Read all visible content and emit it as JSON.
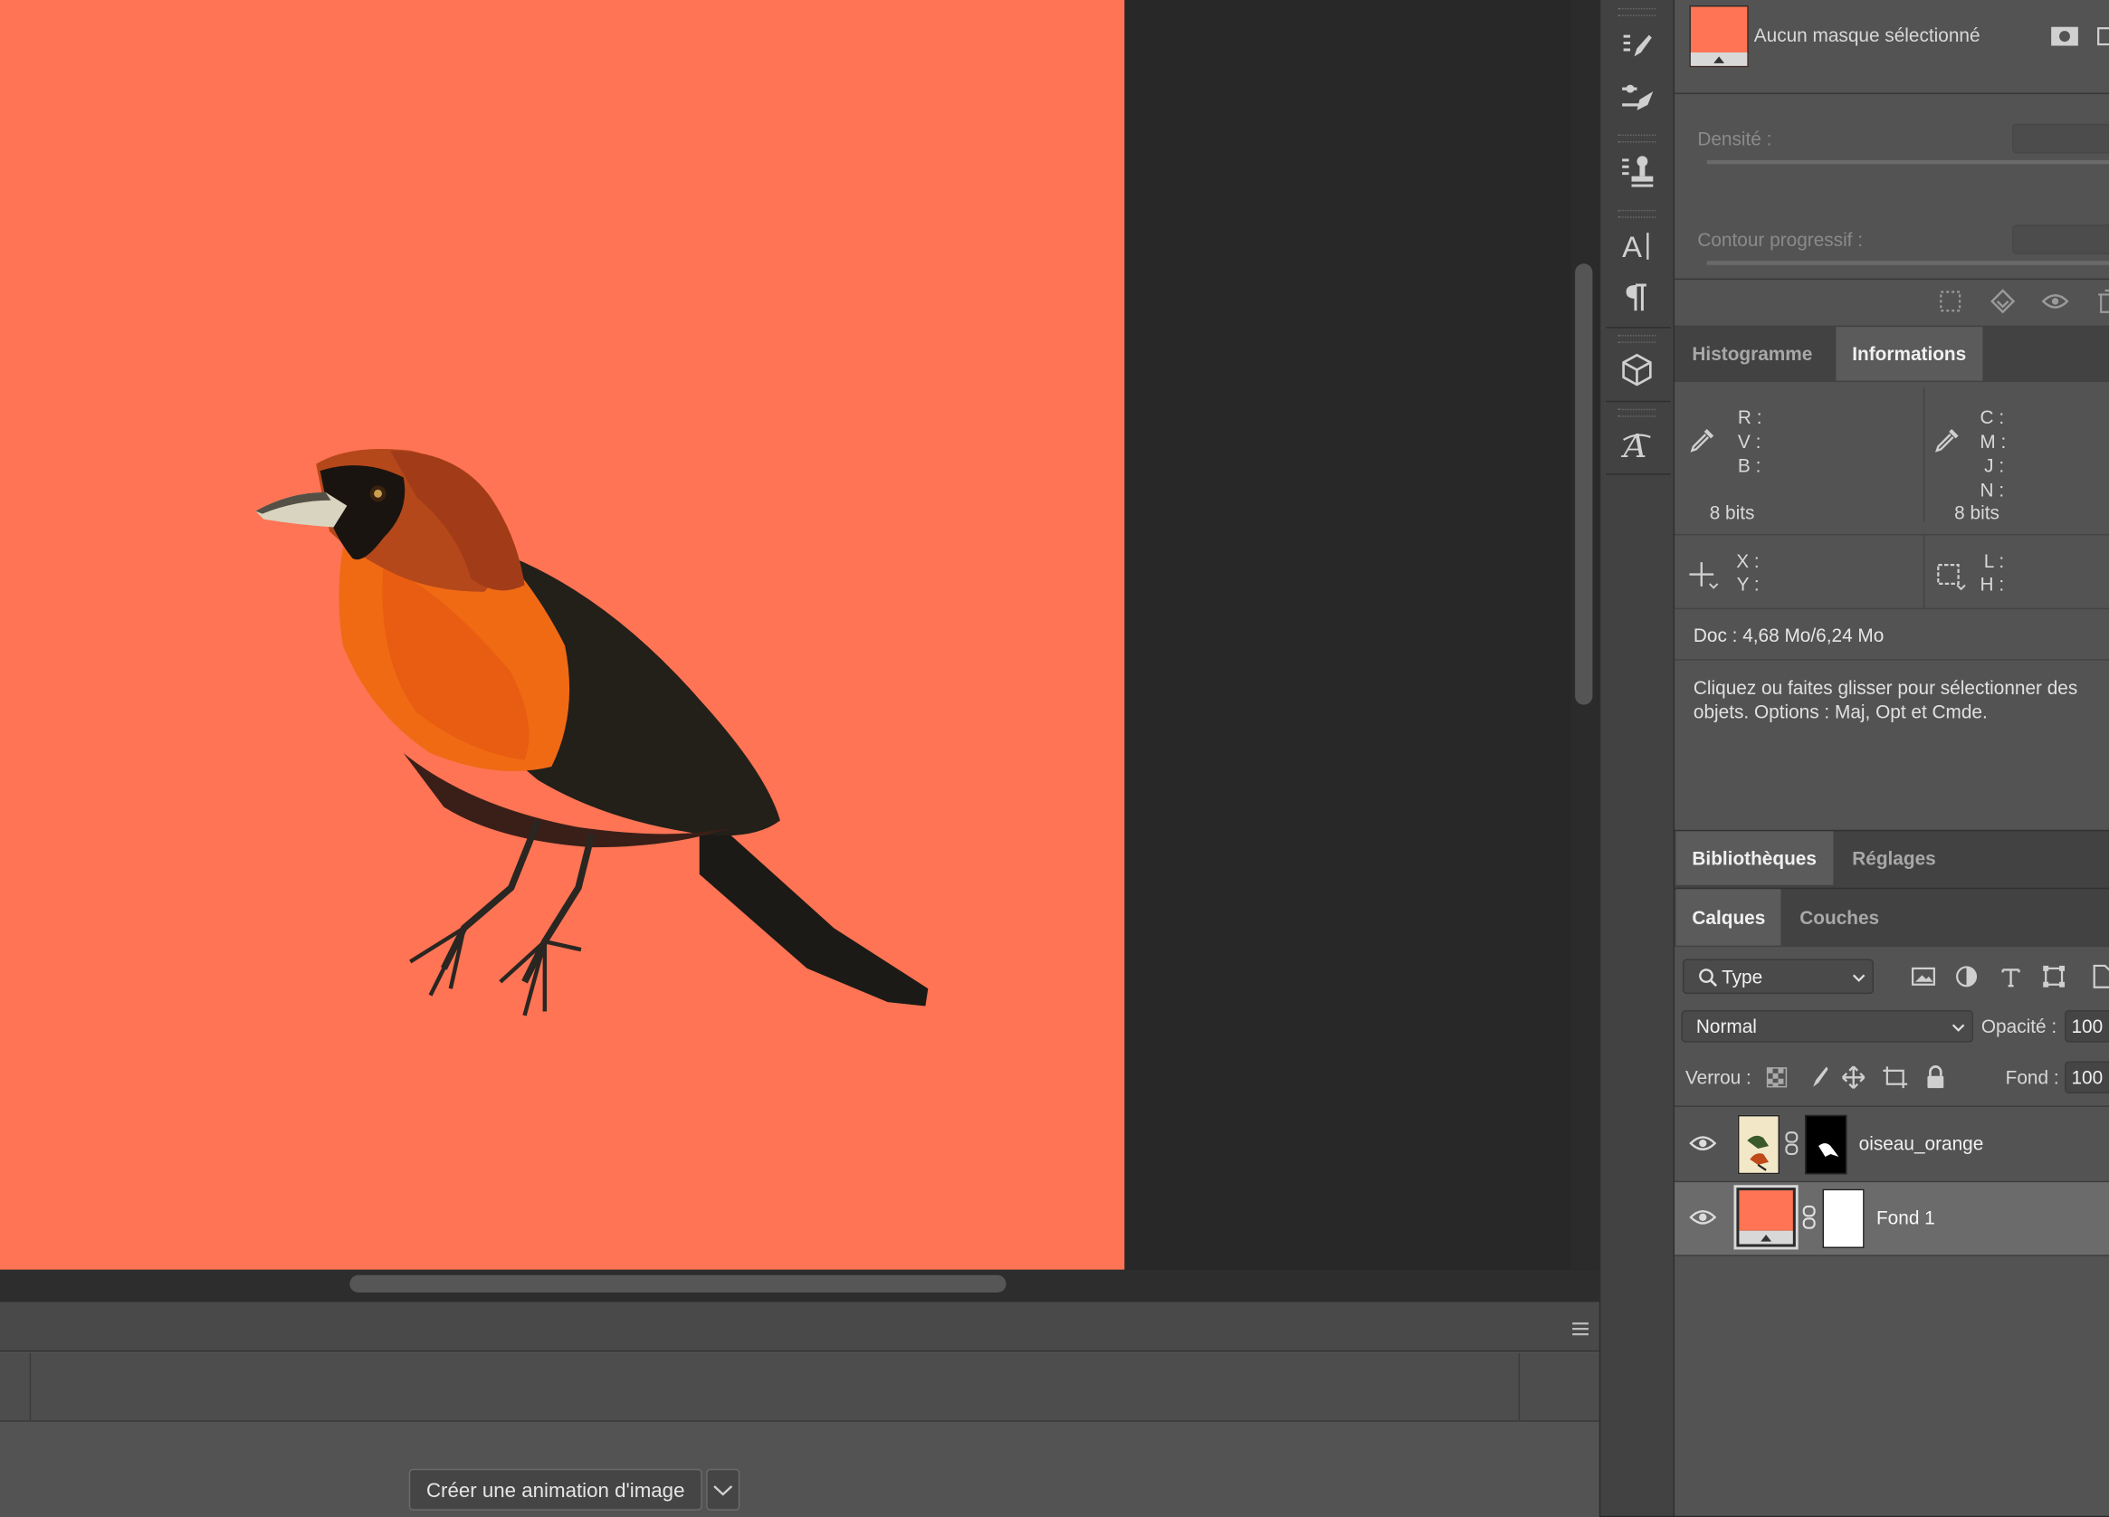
{
  "properties": {
    "mask_label": "Aucun masque sélectionné",
    "density_label": "Densité :",
    "feather_label": "Contour progressif :"
  },
  "info_tabs": [
    "Histogramme",
    "Informations"
  ],
  "info": {
    "rgb_labels": [
      "R :",
      "V :",
      "B :"
    ],
    "cmyk_labels": [
      "C :",
      "M :",
      "J :",
      "N :"
    ],
    "bits_left": "8 bits",
    "bits_right": "8 bits",
    "xy_labels": [
      "X :",
      "Y :"
    ],
    "lh_labels": [
      "L :",
      "H :"
    ],
    "doc": "Doc : 4,68 Mo/6,24 Mo",
    "hint_line1": "Cliquez ou faites glisser pour sélectionner des",
    "hint_line2": "objets. Options : Maj, Opt et Cmde."
  },
  "lib_tabs": [
    "Bibliothèques",
    "Réglages"
  ],
  "layer_tabs": [
    "Calques",
    "Couches"
  ],
  "layers_panel": {
    "filter_value": "Type",
    "blend_mode": "Normal",
    "opacity_label": "Opacité :",
    "opacity_value": "100",
    "lock_label": "Verrou :",
    "fill_label": "Fond :",
    "fill_value": "100"
  },
  "layers": [
    {
      "name": "oiseau_orange",
      "visible": true,
      "selected": false
    },
    {
      "name": "Fond 1",
      "visible": true,
      "selected": true
    }
  ],
  "timeline": {
    "create_button": "Créer une animation d'image"
  },
  "colors": {
    "canvas": "#fe7454",
    "workspace": "#282828",
    "panel": "#535353"
  }
}
